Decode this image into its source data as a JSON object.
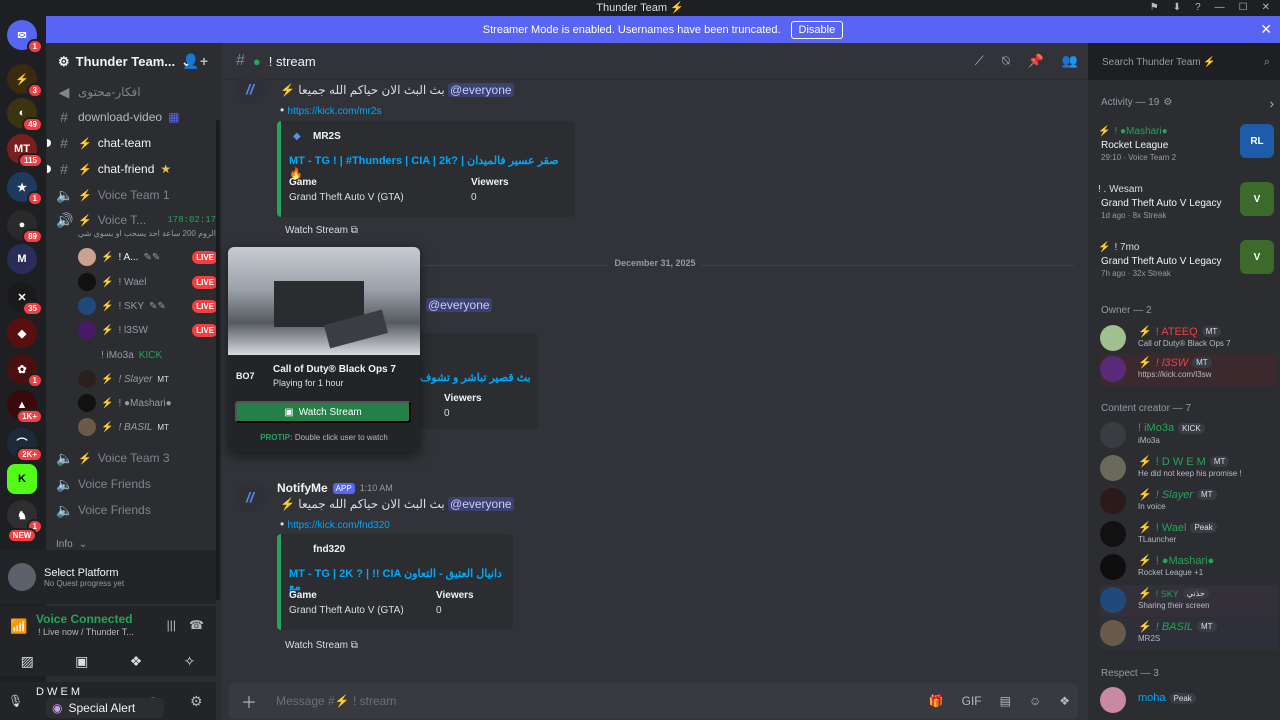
{
  "titlebar": {
    "title": "Thunder Team ⚡"
  },
  "banner": {
    "text": "Streamer Mode is enabled. Usernames have been truncated.",
    "button": "Disable"
  },
  "guilds": [
    {
      "badge": "1"
    },
    {
      "badge": "3"
    },
    {
      "badge": "49"
    },
    {
      "badge": "115"
    },
    {
      "badge": "1"
    },
    {
      "badge": "89"
    },
    {
      "badge": ""
    },
    {
      "badge": "35"
    },
    {
      "badge": ""
    },
    {
      "badge": "1"
    },
    {
      "badge": "1K+"
    },
    {
      "badge": "2K+"
    },
    {
      "badge": ""
    },
    {
      "badge": "1"
    },
    {
      "badge": "NEW"
    }
  ],
  "server": {
    "name": "Thunder Team..."
  },
  "channels": {
    "items": [
      {
        "name": "افكار-محتوى"
      },
      {
        "name": "download-video"
      },
      {
        "name": "chat-team"
      },
      {
        "name": "chat-friend"
      },
      {
        "name": "Voice Team 1"
      },
      {
        "name": "Voice T...",
        "timer": "178:02:17",
        "topic": "الروم 200 ساعة احد يسحب او يسوي شي"
      },
      {
        "name": "Voice Team 3"
      },
      {
        "name": "Voice Friends"
      },
      {
        "name": "Voice Friends"
      },
      {
        "name": "Info"
      }
    ],
    "voice_users": [
      {
        "name": "! A...",
        "live": "LIVE"
      },
      {
        "name": "! Wael",
        "live": "LIVE"
      },
      {
        "name": "! SKY",
        "live": "LIVE"
      },
      {
        "name": "! l3SW",
        "live": "LIVE"
      },
      {
        "name": "! iMo3a",
        "extra": "KICK"
      },
      {
        "name": "! Slayer",
        "extra": "MT"
      },
      {
        "name": "! ●Mashari●",
        "extra": ""
      },
      {
        "name": "! BASIL",
        "extra": "MT"
      }
    ]
  },
  "quest": {
    "title": "Select Platform",
    "sub": "No Quest progress yet"
  },
  "voice": {
    "status": "Voice Connected",
    "sub": "! Live now / Thunder T..."
  },
  "user": {
    "name": "D W E M",
    "alert": "Special Alert"
  },
  "header": {
    "channel": "! stream"
  },
  "search": {
    "placeholder": "Search Thunder Team ⚡"
  },
  "messages": {
    "m1": {
      "text": "⚡ بث البث الان حياكم الله جميعا",
      "mention": "@everyone",
      "link": "https://kick.com/mr2s",
      "embed": {
        "author": "MR2S",
        "title": "MT - TG ! | #Thunders | CIA | 2k? | صقر عسير فالميدان 🔥",
        "game_label": "Game",
        "game": "Grand Theft Auto V (GTA)",
        "viewers_label": "Viewers",
        "viewers": "0"
      },
      "watch": "Watch Stream"
    },
    "date": "December 31, 2025",
    "m2": {
      "mention": "@everyone",
      "title": "بث قصير تباشر و تشوف",
      "viewers_label": "Viewers",
      "viewers": "0"
    },
    "m3": {
      "author": "NotifyMe",
      "app": "APP",
      "time": "1:10 AM",
      "text": "⚡ بث البث الان حياكم الله جميعا",
      "mention": "@everyone",
      "link": "https://kick.com/fnd320",
      "embed": {
        "author": "fnd320",
        "title": "MT - TG | 2K ? | !! CIA دانيال العتيق - التعاون مع",
        "game_label": "Game",
        "game": "Grand Theft Auto V (GTA)",
        "viewers_label": "Viewers",
        "viewers": "0"
      },
      "watch": "Watch Stream"
    }
  },
  "popup": {
    "game": "Call of Duty® Black Ops 7",
    "playing": "Playing for 1 hour",
    "button": "Watch Stream",
    "tip_label": "PROTIP:",
    "tip": "Double click user to watch",
    "icon": "BO7"
  },
  "composer": {
    "placeholder": "Message #⚡ ! stream"
  },
  "members": {
    "activity_header": "Activity — 19",
    "activities": [
      {
        "user": "! ●Mashari●",
        "game": "Rocket League",
        "meta": "29:10  ·  Voice Team 2"
      },
      {
        "user": "! . Wesam",
        "game": "Grand Theft Auto V Legacy",
        "meta": "1d ago  ·  8x Streak"
      },
      {
        "user": "! 7mo",
        "game": "Grand Theft Auto V Legacy",
        "meta": "7h ago  ·  32x Streak"
      }
    ],
    "owner_header": "Owner — 2",
    "owners": [
      {
        "name": "! ATEEQ",
        "tag": "MT",
        "status": "Call of Duty® Black Ops 7"
      },
      {
        "name": "! l3SW",
        "tag": "MT",
        "status": "https://kick.com/l3sw"
      }
    ],
    "creator_header": "Content creator — 7",
    "creators": [
      {
        "name": "! iMo3a",
        "tag": "KICK",
        "status": "iMo3a",
        "color": "#23a55a"
      },
      {
        "name": "! D W E M",
        "tag": "MT",
        "status": "He did not keep his promise !",
        "color": "#23a55a"
      },
      {
        "name": "! Slayer",
        "tag": "MT",
        "status": "In voice",
        "color": "#23a55a"
      },
      {
        "name": "! Wael",
        "tag": "Peak",
        "status": "TLauncher",
        "color": "#23a55a"
      },
      {
        "name": "! ●Mashari●",
        "tag": "",
        "status": "Rocket League +1",
        "color": "#23a55a"
      },
      {
        "name": "! SKY",
        "tag": "حذني",
        "status": "Sharing their screen",
        "color": "#23a55a"
      },
      {
        "name": "! BASIL",
        "tag": "MT",
        "status": "MR2S",
        "color": "#23a55a"
      }
    ],
    "respect_header": "Respect — 3",
    "respect": [
      {
        "name": "moha",
        "tag": "Peak"
      }
    ]
  }
}
